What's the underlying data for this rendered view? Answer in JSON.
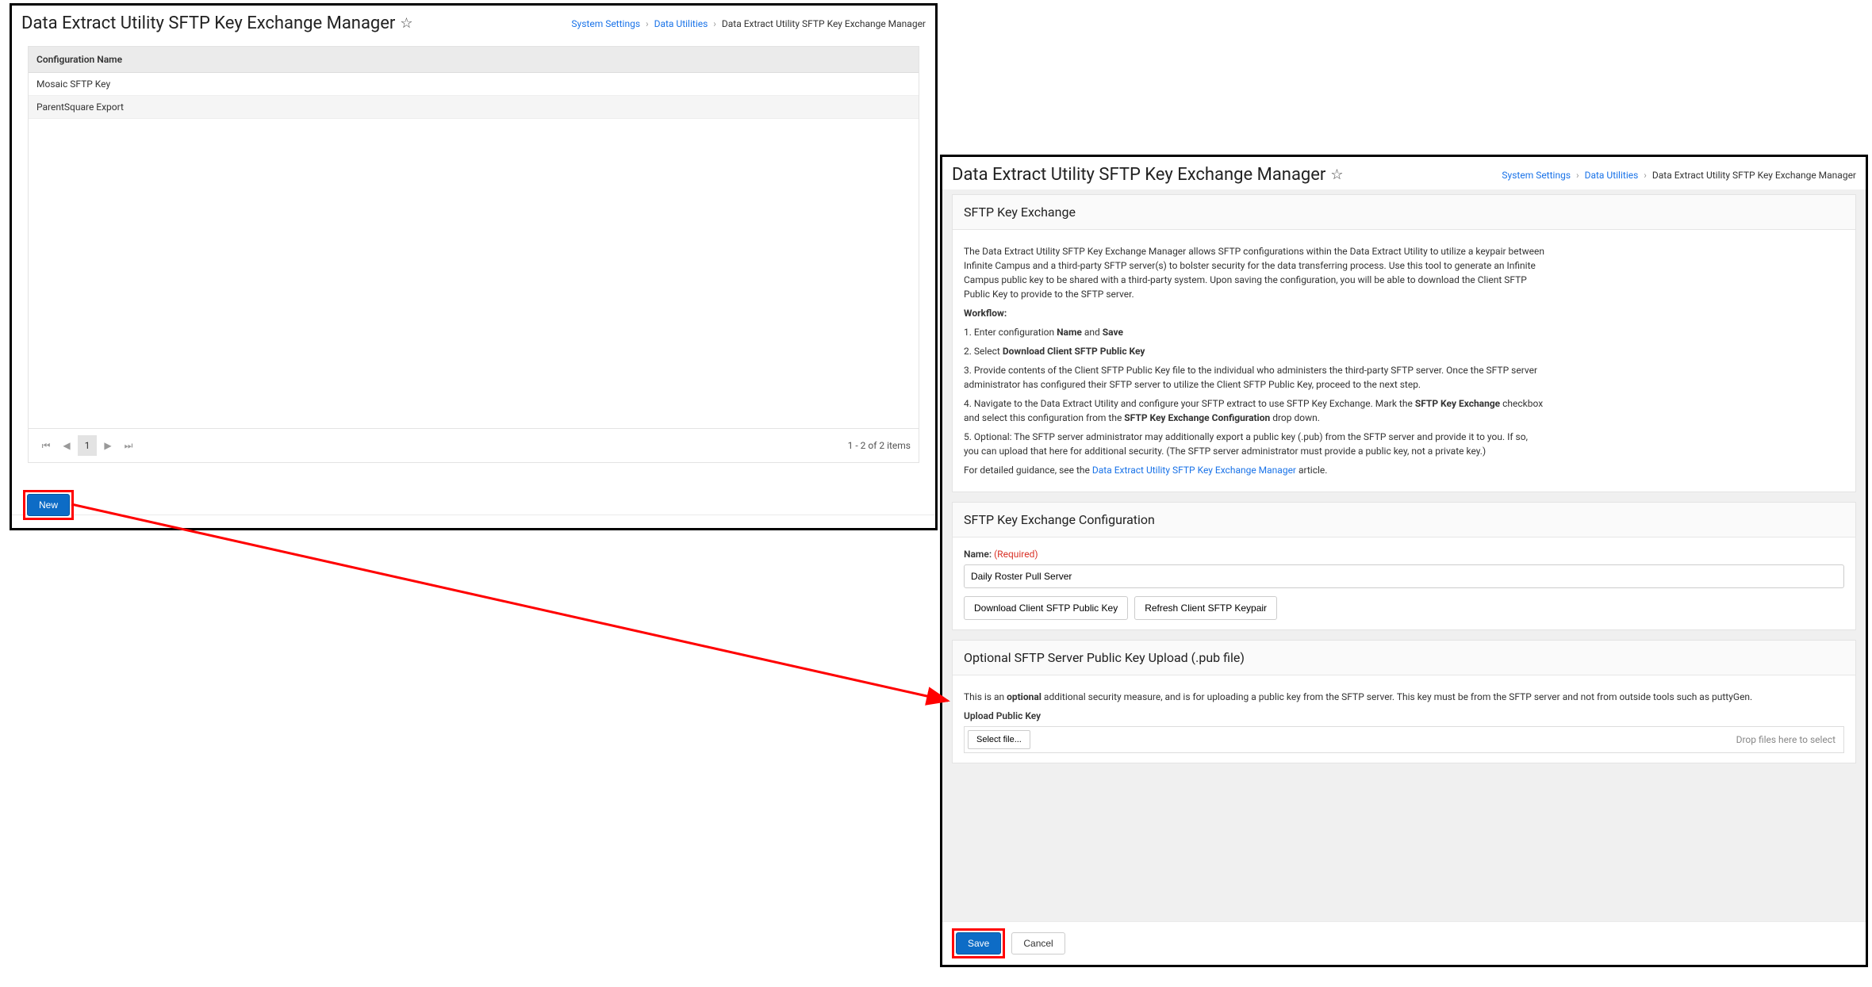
{
  "left": {
    "title": "Data Extract Utility SFTP Key Exchange Manager",
    "breadcrumb": {
      "a": "System Settings",
      "b": "Data Utilities",
      "c": "Data Extract Utility SFTP Key Exchange Manager"
    },
    "grid": {
      "column": "Configuration Name",
      "rows": [
        "Mosaic SFTP Key",
        "ParentSquare Export"
      ],
      "page": "1",
      "info": "1 - 2 of 2 items"
    },
    "new_btn": "New"
  },
  "right": {
    "title": "Data Extract Utility SFTP Key Exchange Manager",
    "breadcrumb": {
      "a": "System Settings",
      "b": "Data Utilities",
      "c": "Data Extract Utility SFTP Key Exchange Manager"
    },
    "intro": {
      "heading": "SFTP Key Exchange",
      "p1": "The Data Extract Utility SFTP Key Exchange Manager allows SFTP configurations within the Data Extract Utility to utilize a keypair between Infinite Campus and a third-party SFTP server(s) to bolster security for the data transferring process. Use this tool to generate an Infinite Campus public key to be shared with a third-party system. Upon saving the configuration, you will be able to download the Client SFTP Public Key to provide to the SFTP server.",
      "workflow_label": "Workflow:",
      "step1_a": "1. Enter configuration ",
      "step1_b": "Name",
      "step1_c": " and ",
      "step1_d": "Save",
      "step2_a": "2. Select ",
      "step2_b": "Download Client SFTP Public Key",
      "step3": "3. Provide contents of the Client SFTP Public Key file to the individual who administers the third-party SFTP server. Once the SFTP server administrator has configured their SFTP server to utilize the Client SFTP Public Key, proceed to the next step.",
      "step4_a": "4. Navigate to the Data Extract Utility and configure your SFTP extract to use SFTP Key Exchange. Mark the ",
      "step4_b": "SFTP Key Exchange",
      "step4_c": " checkbox and select this configuration from the ",
      "step4_d": "SFTP Key Exchange Configuration",
      "step4_e": " drop down.",
      "step5": "5. Optional: The SFTP server administrator may additionally export a public key (.pub) from the SFTP server and provide it to you. If so, you can upload that here for additional security. (The SFTP server administrator must provide a public key, not a private key.)",
      "closing_a": "For detailed guidance, see the ",
      "closing_link": "Data Extract Utility SFTP Key Exchange Manager",
      "closing_b": " article."
    },
    "config": {
      "heading": "SFTP Key Exchange Configuration",
      "name_label": "Name:",
      "required": "(Required)",
      "name_value": "Daily Roster Pull Server",
      "download_btn": "Download Client SFTP Public Key",
      "refresh_btn": "Refresh Client SFTP Keypair"
    },
    "upload": {
      "heading": "Optional SFTP Server Public Key Upload (.pub file)",
      "note_a": "This is an ",
      "note_b": "optional",
      "note_c": " additional security measure, and is for uploading a public key from the SFTP server. This key must be from the SFTP server and not from outside tools such as puttyGen.",
      "label": "Upload Public Key",
      "select_btn": "Select file...",
      "hint": "Drop files here to select"
    },
    "save_btn": "Save",
    "cancel_btn": "Cancel"
  }
}
